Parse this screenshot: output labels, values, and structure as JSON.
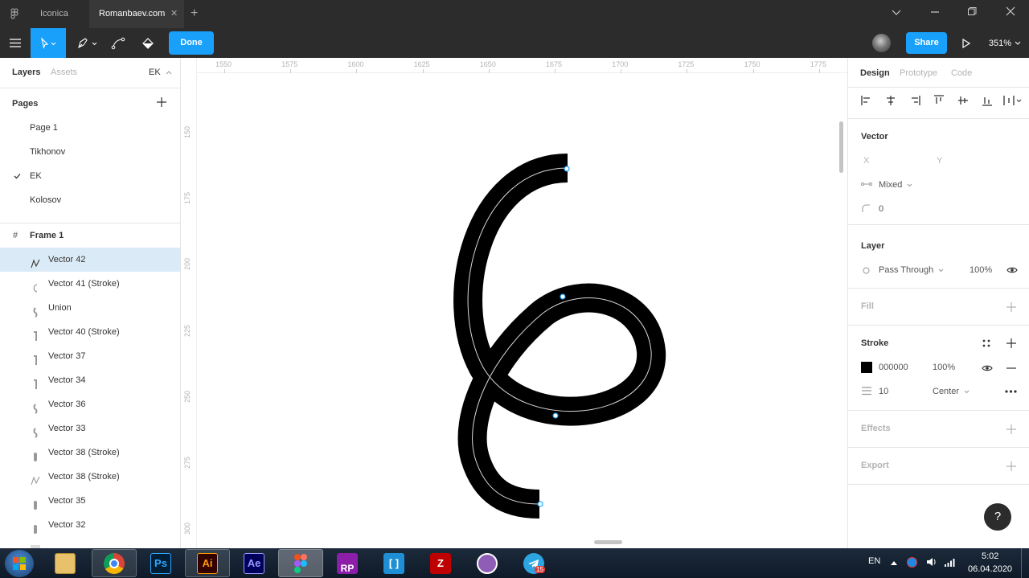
{
  "titlebar": {
    "tabs": [
      {
        "label": "Iconica"
      },
      {
        "label": "Romanbaev.com"
      }
    ]
  },
  "toolbar": {
    "done_label": "Done",
    "share_label": "Share",
    "zoom": "351%"
  },
  "left_panel": {
    "tab_layers": "Layers",
    "tab_assets": "Assets",
    "page_selector": "EK",
    "pages_title": "Pages",
    "pages": [
      {
        "label": "Page 1"
      },
      {
        "label": "Tikhonov"
      },
      {
        "label": "EK"
      },
      {
        "label": "Kolosov"
      }
    ],
    "frame_label": "Frame 1",
    "layers": [
      {
        "label": "Vector 42"
      },
      {
        "label": "Vector 41 (Stroke)"
      },
      {
        "label": "Union"
      },
      {
        "label": "Vector 40 (Stroke)"
      },
      {
        "label": "Vector 37"
      },
      {
        "label": "Vector 34"
      },
      {
        "label": "Vector 36"
      },
      {
        "label": "Vector 33"
      },
      {
        "label": "Vector 38 (Stroke)"
      },
      {
        "label": "Vector 38 (Stroke)"
      },
      {
        "label": "Vector 35"
      },
      {
        "label": "Vector 32"
      }
    ]
  },
  "canvas": {
    "ruler_top": [
      "1550",
      "1575",
      "1600",
      "1625",
      "1650",
      "1675",
      "1700",
      "1725",
      "1750",
      "1775"
    ],
    "ruler_left": [
      "150",
      "175",
      "200",
      "225",
      "250",
      "275",
      "300"
    ]
  },
  "right_panel": {
    "tabs": [
      {
        "label": "Design"
      },
      {
        "label": "Prototype"
      },
      {
        "label": "Code"
      }
    ],
    "vector_title": "Vector",
    "x_label": "X",
    "y_label": "Y",
    "constraint_value": "Mixed",
    "radius_value": "0",
    "layer_title": "Layer",
    "blend_mode": "Pass Through",
    "layer_opacity": "100%",
    "fill_title": "Fill",
    "stroke_title": "Stroke",
    "stroke_color": "000000",
    "stroke_opacity": "100%",
    "stroke_weight": "10",
    "stroke_align": "Center",
    "effects_title": "Effects",
    "export_title": "Export",
    "help_label": "?"
  },
  "taskbar": {
    "lang": "EN",
    "time": "5:02",
    "date": "06.04.2020",
    "apps": [
      {
        "name": "explorer"
      },
      {
        "name": "chrome"
      },
      {
        "label": "Ps"
      },
      {
        "label": "Ai"
      },
      {
        "label": "Ae"
      },
      {
        "name": "figma"
      },
      {
        "label": "RP"
      },
      {
        "name": "brackets"
      },
      {
        "name": "filezilla"
      },
      {
        "name": "github"
      },
      {
        "name": "telegram",
        "badge": "15"
      }
    ]
  },
  "colors": {
    "accent": "#18a0fb",
    "dark_ui": "#2c2c2c",
    "selection": "#daebf7",
    "stroke": "#000000"
  }
}
